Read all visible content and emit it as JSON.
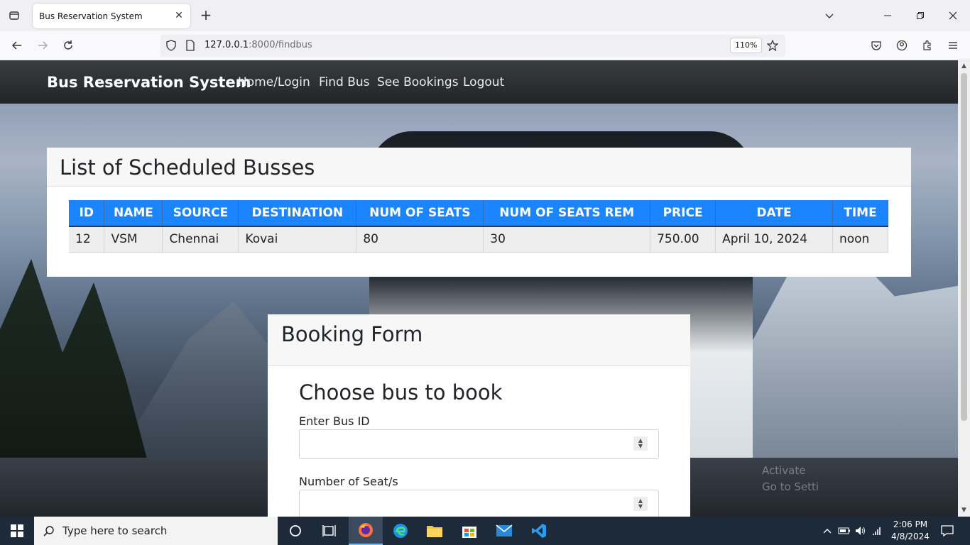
{
  "browser": {
    "tab_title": "Bus Reservation System",
    "url_host": "127.0.0.1",
    "url_rest": ":8000/findbus",
    "zoom": "110%"
  },
  "site": {
    "brand": "Bus Reservation System",
    "nav": [
      "Home/Login",
      "Find Bus",
      "See Bookings",
      "Logout"
    ]
  },
  "bus_list": {
    "title": "List of Scheduled Busses",
    "columns": [
      "ID",
      "NAME",
      "SOURCE",
      "DESTINATION",
      "NUM OF SEATS",
      "NUM OF SEATS REM",
      "PRICE",
      "DATE",
      "TIME"
    ],
    "rows": [
      [
        "12",
        "VSM",
        "Chennai",
        "Kovai",
        "80",
        "30",
        "750.00",
        "April 10, 2024",
        "noon"
      ]
    ]
  },
  "booking_form": {
    "title": "Booking Form",
    "subtitle": "Choose bus to book",
    "bus_id_label": "Enter Bus ID",
    "bus_id_value": "",
    "seats_label": "Number of Seat/s",
    "seats_value": ""
  },
  "watermark": {
    "line1": "Activate",
    "line2": "Go to Setti"
  },
  "taskbar": {
    "search_placeholder": "Type here to search",
    "time": "2:06 PM",
    "date": "4/8/2024"
  }
}
